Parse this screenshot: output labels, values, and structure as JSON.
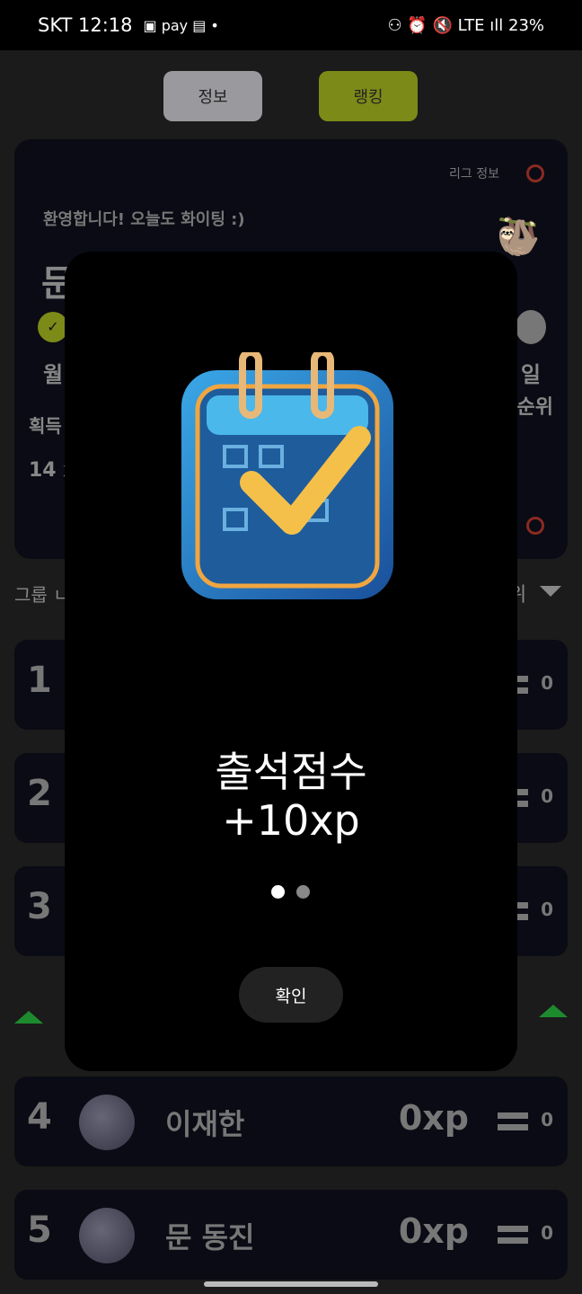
{
  "status_bar": {
    "carrier_time": "SKT 12:18",
    "icons_left": "▣ pay ▤ •",
    "right": "⚇ ⏰ 🔇 LTE ıll 23%"
  },
  "tabs": [
    {
      "label": "정보",
      "active": false
    },
    {
      "label": "랭킹",
      "active": true
    }
  ],
  "league_card": {
    "league_info": "리그 정보",
    "greeting": "환영합니다! 오늘도 화이팅 :)",
    "name_partial": "문",
    "day_first": "월",
    "day_last": "일",
    "rank_label_partial": "순위",
    "earned_label_partial": "획득",
    "earned_value_partial": "14 x"
  },
  "group_header": {
    "left_partial": "그룹 ㄴ",
    "right_partial": "위"
  },
  "ranking": [
    {
      "rank": "1",
      "change": "0"
    },
    {
      "rank": "2",
      "change": "0"
    },
    {
      "rank": "3",
      "change": "0"
    },
    {
      "rank": "4",
      "name": "이재한",
      "xp": "0xp",
      "change": "0"
    },
    {
      "rank": "5",
      "name": "문 동진",
      "xp": "0xp",
      "change": "0"
    }
  ],
  "modal": {
    "title": "출석점수",
    "reward": "+10xp",
    "page_count": 2,
    "current_page": 1,
    "confirm": "확인",
    "image": "calendar-check-icon"
  },
  "colors": {
    "accent": "#8a9a1c",
    "promote": "#1e8a2e",
    "alert": "#c0392b"
  }
}
